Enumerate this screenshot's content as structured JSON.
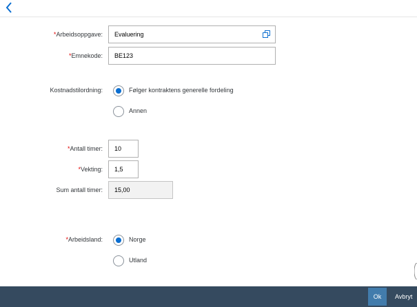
{
  "header": {
    "back_icon": "chevron-left-icon"
  },
  "form": {
    "arbeidsoppgave": {
      "required_mark": "*",
      "label": "Arbeidsoppgave:",
      "value": "Evaluering",
      "icon": "copy-icon"
    },
    "emnekode": {
      "required_mark": "*",
      "label": "Emnekode:",
      "value": "BE123"
    },
    "kostnadstilordning": {
      "label": "Kostnadstilordning:",
      "options": [
        {
          "label": "Følger kontraktens generelle fordeling",
          "selected": true
        },
        {
          "label": "Annen",
          "selected": false
        }
      ]
    },
    "antall_timer": {
      "required_mark": "*",
      "label": "Antall timer:",
      "value": "10"
    },
    "vekting": {
      "required_mark": "*",
      "label": "Vekting:",
      "value": "1,5"
    },
    "sum_antall_timer": {
      "label": "Sum antall timer:",
      "value": "15,00"
    },
    "arbeidsland": {
      "required_mark": "*",
      "label": "Arbeidsland:",
      "options": [
        {
          "label": "Norge",
          "selected": true
        },
        {
          "label": "Utland",
          "selected": false
        }
      ]
    }
  },
  "footer": {
    "ok_label": "Ok",
    "cancel_label": "Avbryt"
  },
  "colors": {
    "accent": "#0a6ed1",
    "footer_bg": "#354a5f",
    "ok_bg": "#427cac",
    "required": "#e00000"
  }
}
